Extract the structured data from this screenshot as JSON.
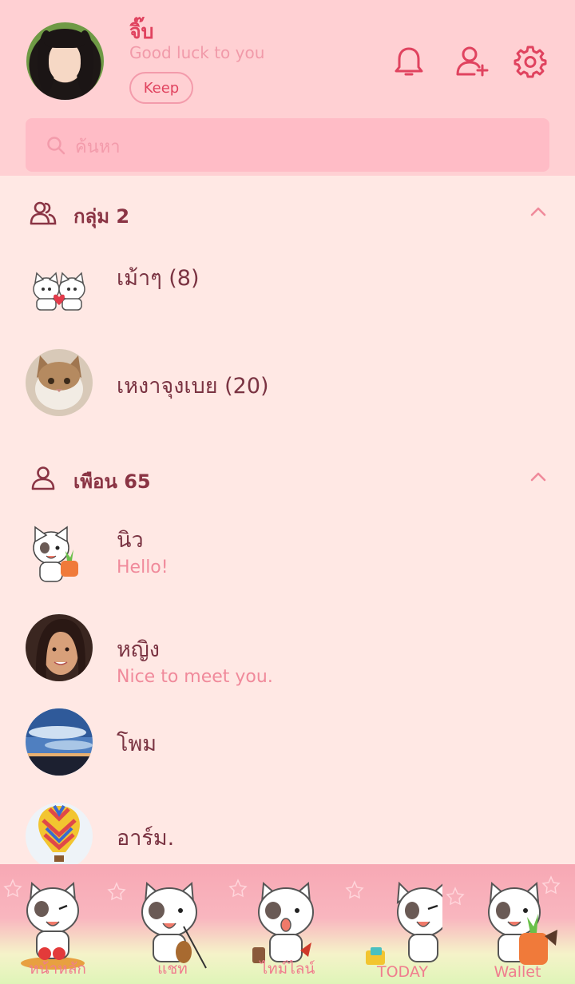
{
  "profile": {
    "name": "จิ๊บ",
    "status": "Good luck to you",
    "keep_label": "Keep"
  },
  "header_icons": [
    "bell-icon",
    "add-friend-icon",
    "gear-icon"
  ],
  "search": {
    "placeholder": "ค้นหา"
  },
  "groups": {
    "title": "กลุ่ม 2",
    "items": [
      {
        "name": "เม้าๆ (8)"
      },
      {
        "name": "เหงาจุงเบย (20)"
      }
    ]
  },
  "friends": {
    "title": "เพือน 65",
    "items": [
      {
        "name": "นิว",
        "message": "Hello!"
      },
      {
        "name": "หญิง",
        "message": "Nice to meet you."
      },
      {
        "name": "โพม",
        "message": ""
      },
      {
        "name": "อาร์ม.",
        "message": ""
      }
    ]
  },
  "tabs": [
    {
      "label": "หน้าหลัก"
    },
    {
      "label": "แชท"
    },
    {
      "label": "ไทม์ไลน์"
    },
    {
      "label": "TODAY"
    },
    {
      "label": "Wallet"
    }
  ],
  "colors": {
    "accent": "#e0435f",
    "header_bg": "#ffd0d3",
    "body_bg": "#ffe8e4",
    "search_bg": "#ffbcc6"
  }
}
